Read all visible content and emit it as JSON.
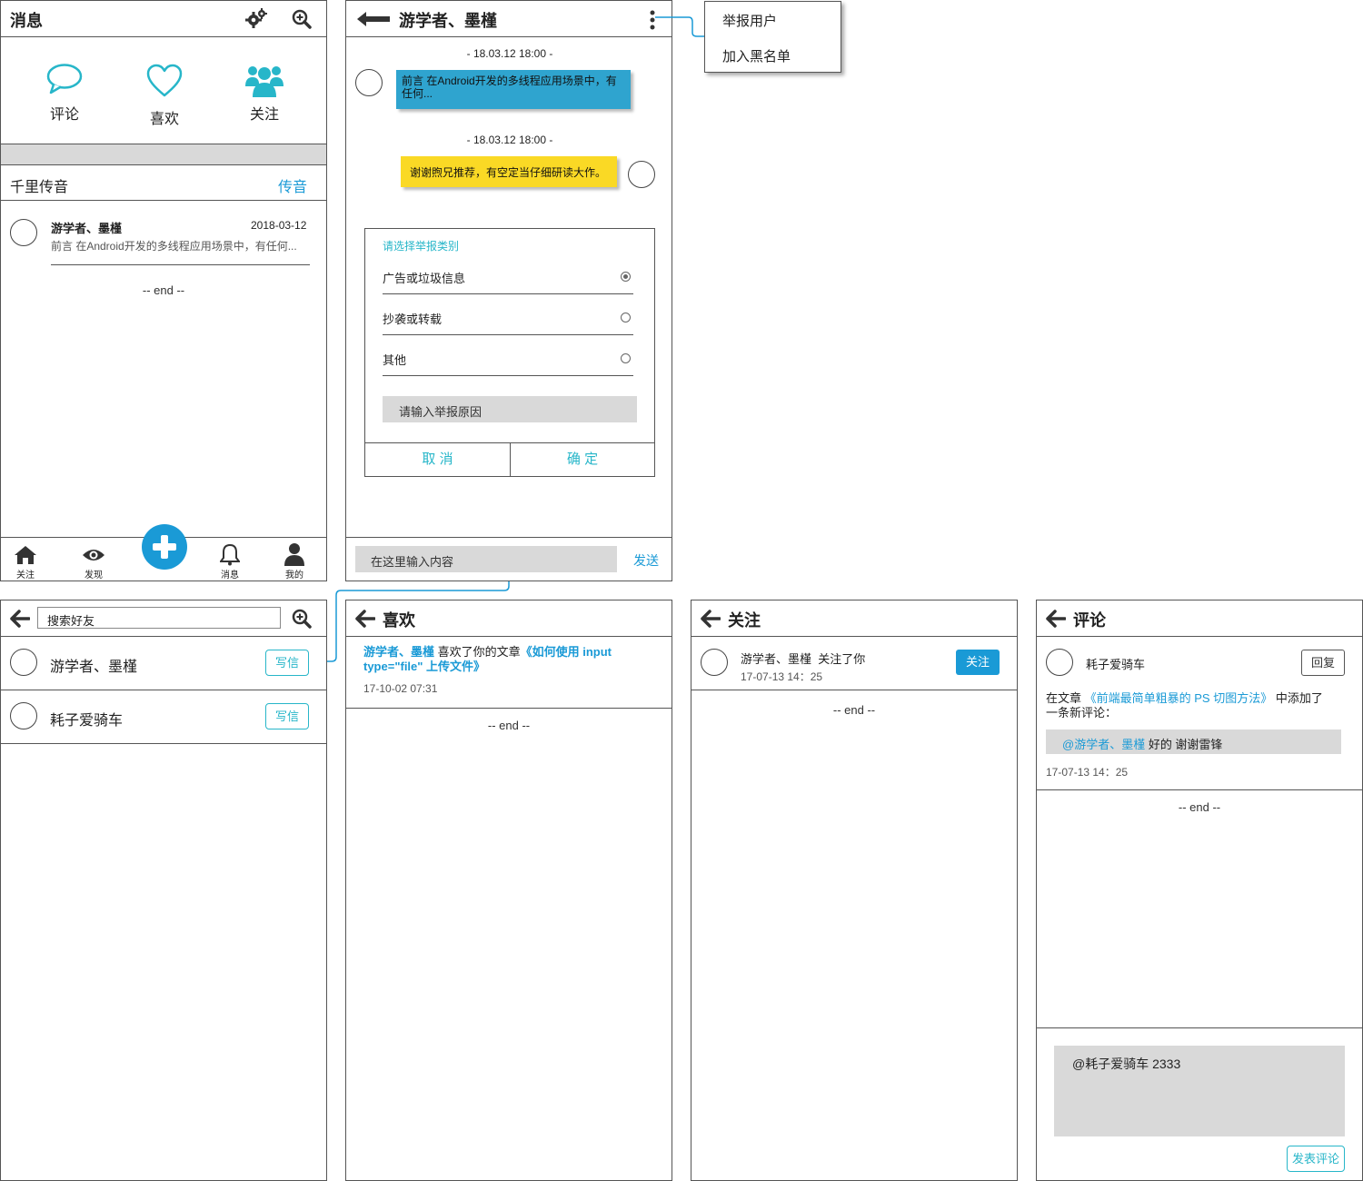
{
  "colors": {
    "accent": "#27b6c9",
    "link": "#1a9ad6",
    "received_bubble": "#2fa4cf",
    "sent_bubble": "#fad925",
    "gray_bar": "#d9d9d9"
  },
  "messages_screen": {
    "title": "消息",
    "categories": [
      {
        "label": "评论",
        "icon": "speech-bubble-icon"
      },
      {
        "label": "喜欢",
        "icon": "heart-icon"
      },
      {
        "label": "关注",
        "icon": "group-users-icon"
      }
    ],
    "section_title": "千里传音",
    "section_action": "传音",
    "item": {
      "name": "游学者、墨槿",
      "date": "2018-03-12",
      "preview": "前言 在Android开发的多线程应用场景中，有任何..."
    },
    "end": "-- end --",
    "tabbar": [
      {
        "label": "关注",
        "icon": "home-icon"
      },
      {
        "label": "发现",
        "icon": "eye-icon"
      },
      {
        "label": "消息",
        "icon": "bell-icon"
      },
      {
        "label": "我的",
        "icon": "user-icon"
      }
    ]
  },
  "chat_screen": {
    "title": "游学者、墨槿",
    "time1": "- 18.03.12 18:00 -",
    "received": "前言 在Android开发的多线程应用场景中，有任何...",
    "time2": "- 18.03.12 18:00 -",
    "sent": "谢谢煦兄推荐，有空定当仔细研读大作。",
    "dialog": {
      "title": "请选择举报类别",
      "options": [
        {
          "label": "广告或垃圾信息",
          "selected": true
        },
        {
          "label": "抄袭或转载",
          "selected": false
        },
        {
          "label": "其他",
          "selected": false
        }
      ],
      "reason_placeholder": "请输入举报原因",
      "cancel": "取 消",
      "confirm": "确 定"
    },
    "input_placeholder": "在这里输入内容",
    "send": "发送"
  },
  "context_menu": {
    "items": [
      "举报用户",
      "加入黑名单"
    ]
  },
  "search_screen": {
    "placeholder": "搜索好友",
    "friends": [
      {
        "name": "游学者、墨槿",
        "action": "写信"
      },
      {
        "name": "耗子爱骑车",
        "action": "写信"
      }
    ]
  },
  "likes_screen": {
    "title": "喜欢",
    "user": "游学者、墨槿",
    "text": " 喜欢了你的文章",
    "article_line1": "《如何使用 input",
    "article_line2": "type=\"file\" 上传文件》",
    "time": "17-10-02 07:31",
    "end": "-- end --"
  },
  "follows_screen": {
    "title": "关注",
    "user": "游学者、墨槿",
    "text": "关注了你",
    "time": "17-07-13 14：25",
    "action": "关注",
    "end": "-- end --"
  },
  "comments_screen": {
    "title": "评论",
    "user": "耗子爱骑车",
    "reply": "回复",
    "prefix": "在文章",
    "article": "《前端最简单粗暴的 PS 切图方法》",
    "suffix": "中添加了",
    "line2": "一条新评论：",
    "quote_mention": "@游学者、墨槿",
    "quote_text": " 好的 谢谢雷锋",
    "time": "17-07-13 14：25",
    "end": "-- end --",
    "compose_text": "@耗子爱骑车 2333",
    "submit": "发表评论"
  }
}
